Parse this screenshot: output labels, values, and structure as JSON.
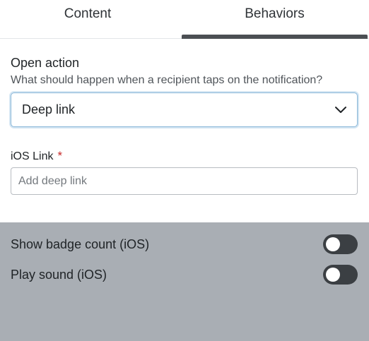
{
  "tabs": [
    {
      "label": "Content",
      "active": false
    },
    {
      "label": "Behaviors",
      "active": true
    }
  ],
  "open_action": {
    "title": "Open action",
    "description": "What should happen when a recipient taps on the notification?",
    "selected_value": "Deep link"
  },
  "ios_link": {
    "label": "iOS Link",
    "required_marker": "*",
    "value": "",
    "placeholder": "Add deep link"
  },
  "toggles": [
    {
      "label": "Show badge count (iOS)",
      "on": false
    },
    {
      "label": "Play sound (iOS)",
      "on": false
    }
  ],
  "colors": {
    "required": "#c62828",
    "active_tab_indicator": "#4b4f53",
    "select_focus_border": "#8ab7d8",
    "overlay_panel": "#a9aeb4",
    "toggle_off": "#3b3f43"
  },
  "icons": {
    "select_chevron": "chevron-down-icon"
  }
}
